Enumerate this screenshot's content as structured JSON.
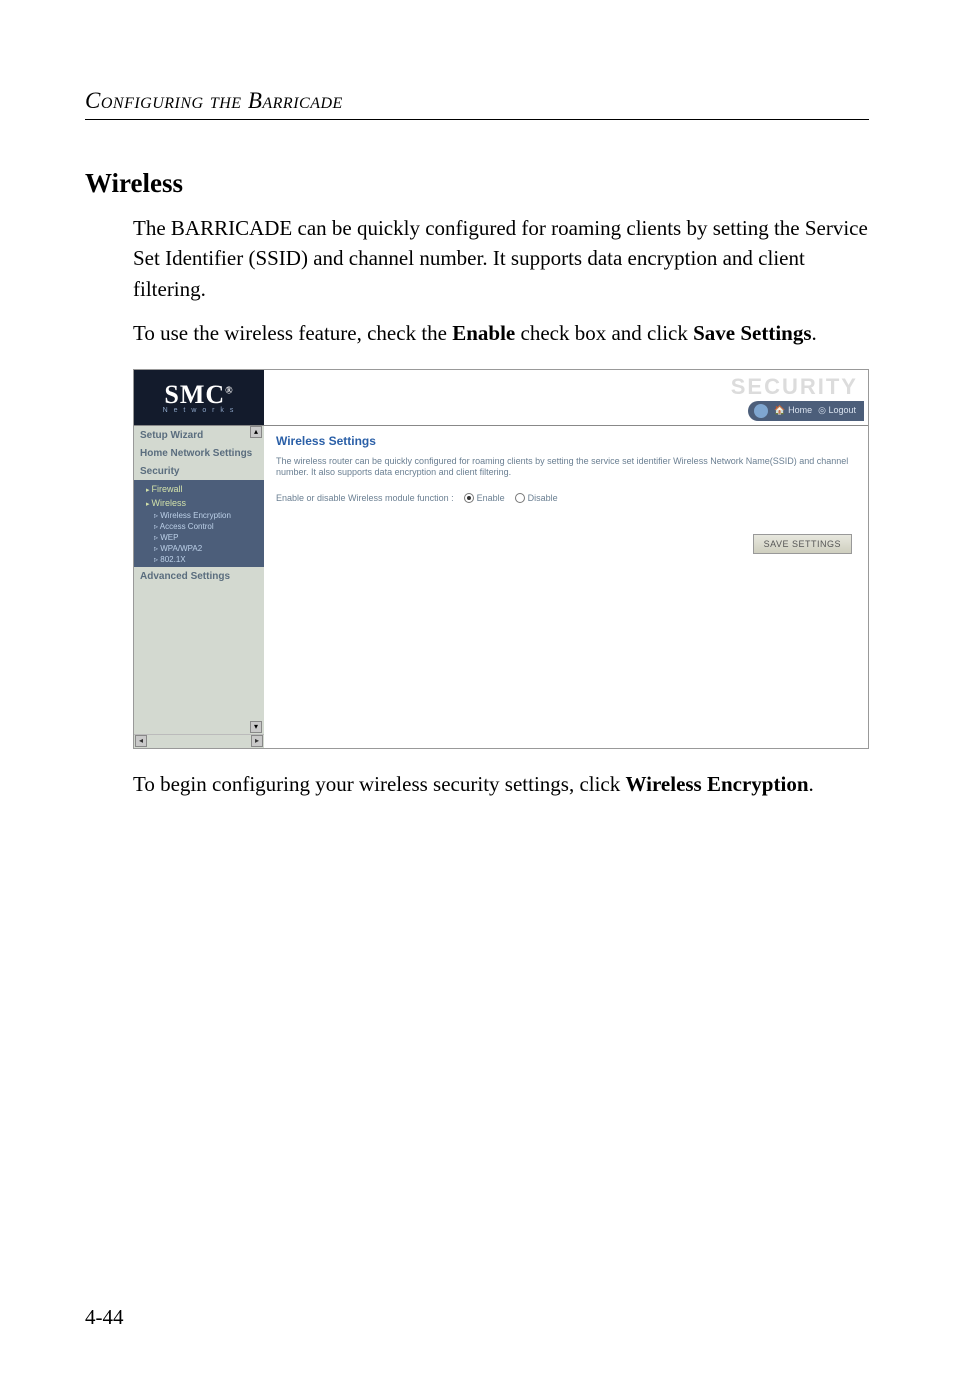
{
  "chapter_header": "Configuring the Barricade",
  "section_title": "Wireless",
  "para1": "The BARRICADE can be quickly configured for roaming clients by setting the Service Set Identifier (SSID) and channel number. It supports data encryption and client filtering.",
  "para2_pre": "To use the wireless feature, check the ",
  "para2_bold1": "Enable",
  "para2_mid": " check box and click ",
  "para2_bold2": "Save Settings",
  "para2_post": ".",
  "para3_pre": "To begin configuring your wireless security settings, click ",
  "para3_bold": "Wireless Encryption",
  "para3_post": ".",
  "page_number": "4-44",
  "screenshot": {
    "logo_main": "SMC",
    "logo_sub": "N e t w o r k s",
    "corner_brand": "SECURITY",
    "link_home": "Home",
    "link_logout": "Logout",
    "nav": {
      "setup_wizard": "Setup Wizard",
      "home_network_settings": "Home Network Settings",
      "security": "Security",
      "firewall": "Firewall",
      "wireless": "Wireless",
      "wireless_encryption": "Wireless Encryption",
      "access_control": "Access Control",
      "wep": "WEP",
      "wpa": "WPA/WPA2",
      "x8021x": "802.1X",
      "advanced_settings": "Advanced Settings"
    },
    "content": {
      "title": "Wireless Settings",
      "desc": "The wireless router can be quickly configured for roaming clients by setting the service set identifier Wireless Network Name(SSID) and channel number. It also supports data encryption and client filtering.",
      "row_label": "Enable or disable Wireless module function :",
      "radio_enable": "Enable",
      "radio_disable": "Disable",
      "save_button": "SAVE SETTINGS"
    }
  }
}
